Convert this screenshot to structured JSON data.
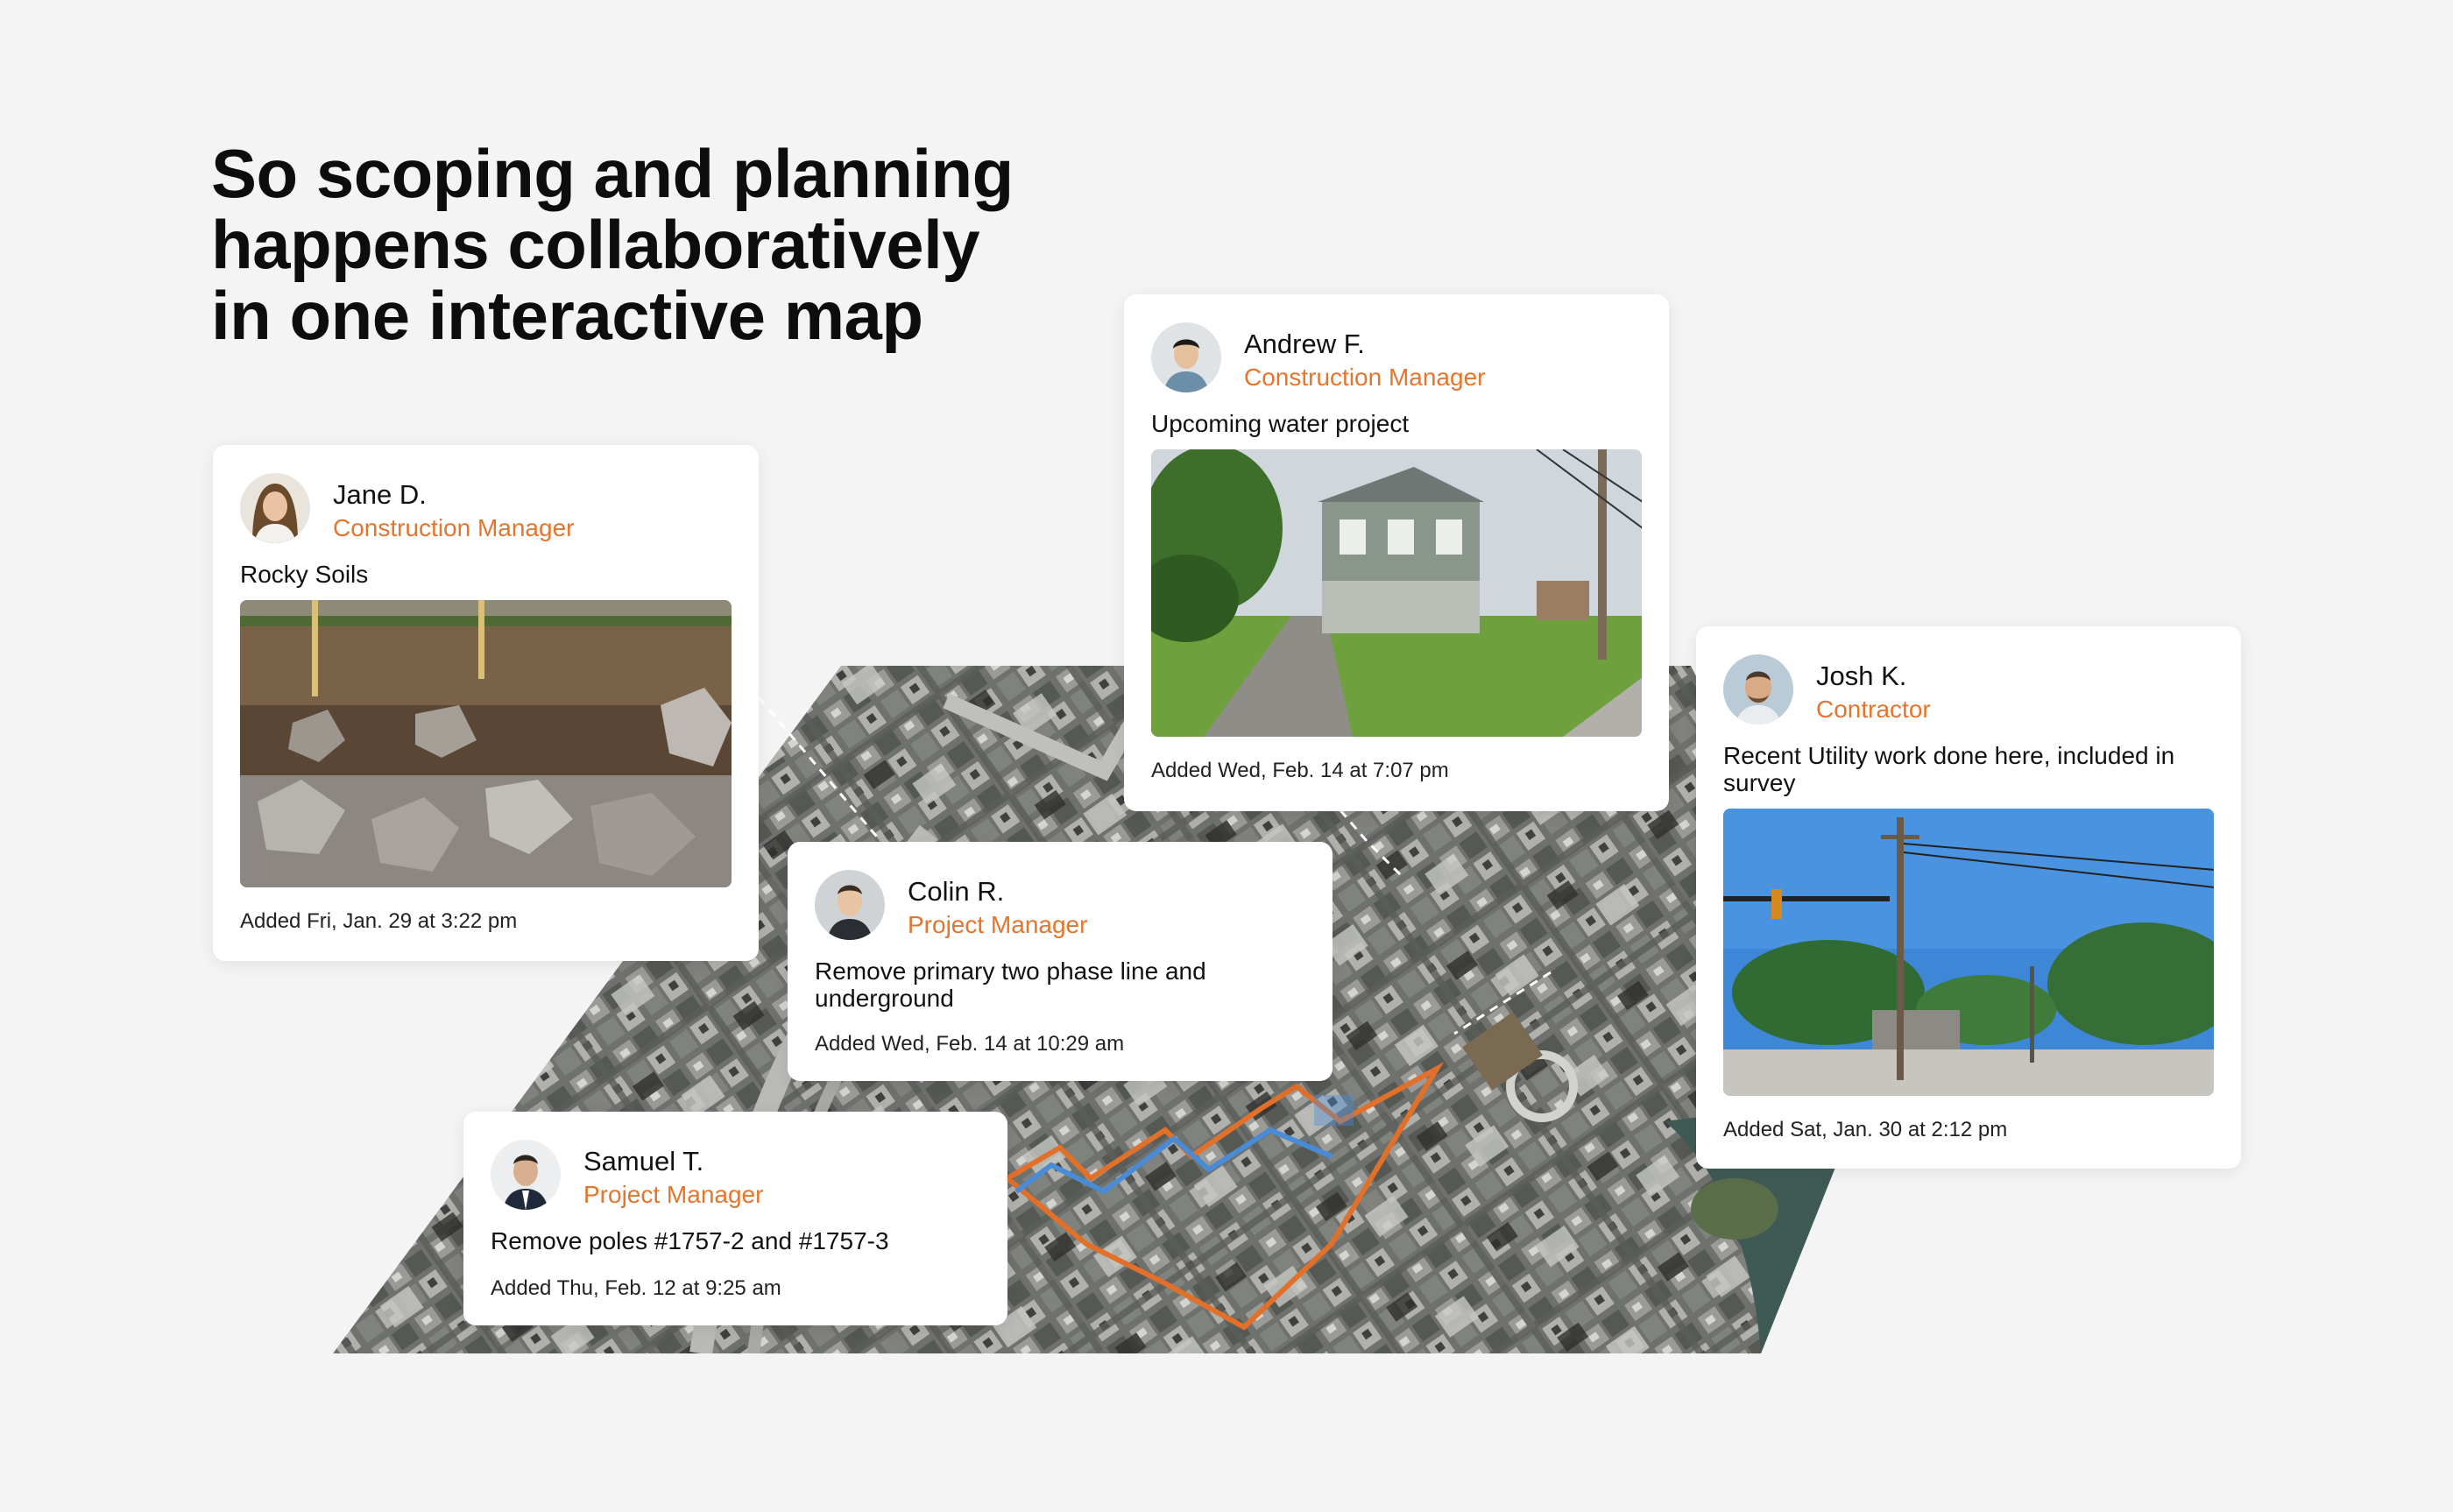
{
  "headline": "So scoping and planning happens collaboratively in one interactive map",
  "cards": [
    {
      "name": "Jane D.",
      "role": "Construction Manager",
      "note": "Rocky Soils",
      "added": "Added Fri, Jan. 29 at 3:22 pm",
      "photo": "rocky-soil-excavation-photo"
    },
    {
      "name": "Andrew F.",
      "role": "Construction Manager",
      "note": "Upcoming water project",
      "added": "Added Wed, Feb. 14 at 7:07 pm",
      "photo": "house-street-photo"
    },
    {
      "name": "Colin R.",
      "role": "Project Manager",
      "note": "Remove primary two phase line and underground",
      "added": "Added Wed, Feb. 14 at 10:29 am"
    },
    {
      "name": "Josh K.",
      "role": "Contractor",
      "note": "Recent Utility work done here, included in survey",
      "added": "Added Sat, Jan. 30 at 2:12 pm",
      "photo": "utility-pole-intersection-photo"
    },
    {
      "name": "Samuel T.",
      "role": "Project Manager",
      "note": "Remove poles #1757-2 and #1757-3",
      "added": "Added Thu, Feb. 12 at 9:25 am"
    }
  ],
  "colors": {
    "accent": "#e5752d",
    "route_orange": "#e0702a",
    "route_blue": "#4a8bd6",
    "background": "#f3f4f3"
  }
}
